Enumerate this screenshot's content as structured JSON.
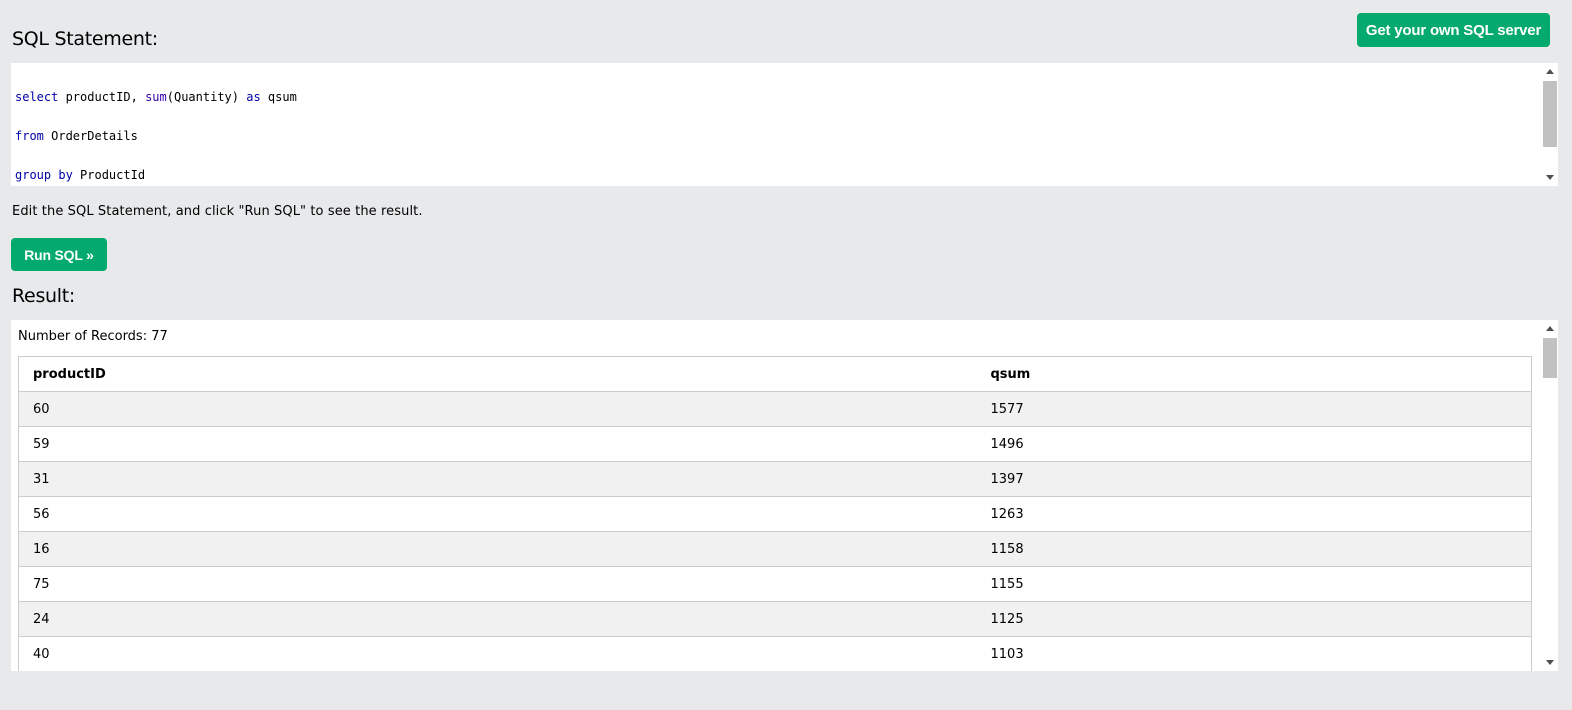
{
  "header": {
    "get_server_label": "Get your own SQL server"
  },
  "sql_section": {
    "title": "SQL Statement:",
    "code_lines": [
      [
        {
          "t": "select",
          "c": "kw"
        },
        {
          "t": " productID, "
        },
        {
          "t": "sum",
          "c": "fn"
        },
        {
          "t": "(Quantity) "
        },
        {
          "t": "as",
          "c": "kw"
        },
        {
          "t": " qsum"
        }
      ],
      [
        {
          "t": "from",
          "c": "kw"
        },
        {
          "t": " OrderDetails"
        }
      ],
      [
        {
          "t": "group",
          "c": "kw"
        },
        {
          "t": " "
        },
        {
          "t": "by",
          "c": "kw"
        },
        {
          "t": " ProductId"
        }
      ]
    ],
    "hint": "Edit the SQL Statement, and click \"Run SQL\" to see the result.",
    "run_label": "Run SQL »"
  },
  "result_section": {
    "title": "Result:",
    "record_count": "Number of Records: 77",
    "columns": [
      "productID",
      "qsum"
    ],
    "rows": [
      [
        "60",
        "1577"
      ],
      [
        "59",
        "1496"
      ],
      [
        "31",
        "1397"
      ],
      [
        "56",
        "1263"
      ],
      [
        "16",
        "1158"
      ],
      [
        "75",
        "1155"
      ],
      [
        "24",
        "1125"
      ],
      [
        "40",
        "1103"
      ]
    ]
  },
  "colors": {
    "accent": "#04aa6d",
    "background": "#e7e9eb",
    "keyword": "#0000aa"
  }
}
